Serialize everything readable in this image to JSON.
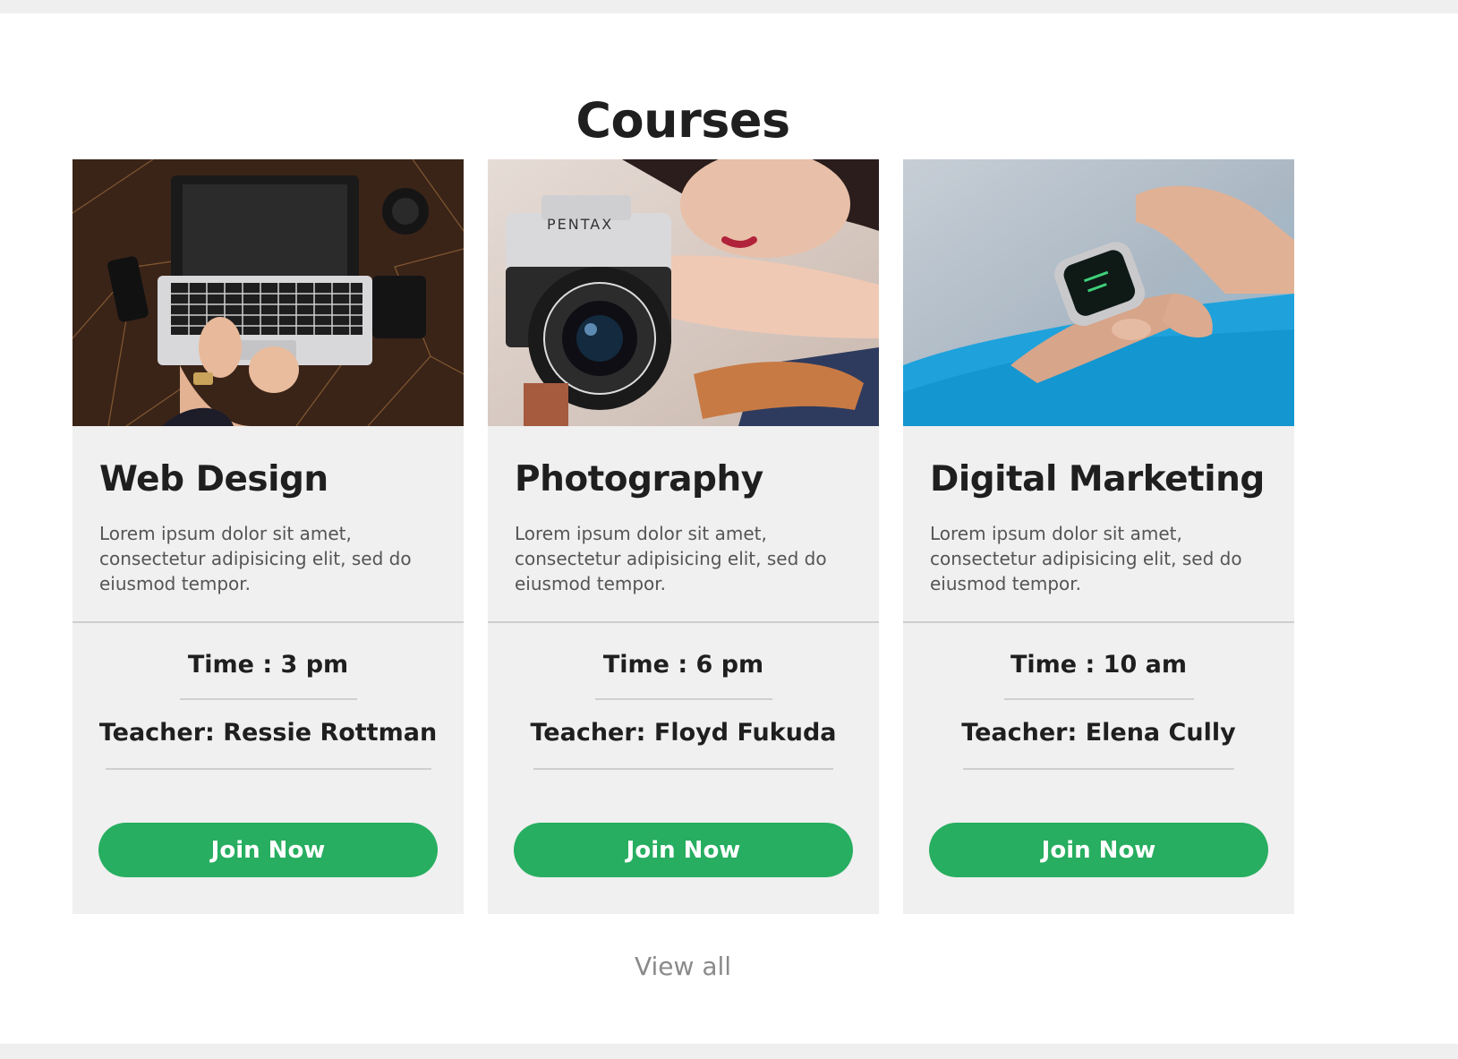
{
  "section": {
    "title": "Courses",
    "view_all_label": "View all"
  },
  "courses": [
    {
      "title": "Web Design",
      "description": "Lorem ipsum dolor sit amet, consectetur adipisicing elit, sed do eiusmod tempor.",
      "time": "Time : 3 pm",
      "teacher": "Teacher: Ressie Rottman",
      "button_label": "Join Now",
      "image": "laptop-on-wooden-desk-photo"
    },
    {
      "title": "Photography",
      "description": "Lorem ipsum dolor sit amet, consectetur adipisicing elit, sed do eiusmod tempor.",
      "time": "Time : 6 pm",
      "teacher": "Teacher: Floyd Fukuda",
      "button_label": "Join Now",
      "image": "pentax-camera-with-woman-photo",
      "image_text": "PENTAX"
    },
    {
      "title": "Digital Marketing",
      "description": "Lorem ipsum dolor sit amet, consectetur adipisicing elit, sed do eiusmod tempor.",
      "time": "Time : 10 am",
      "teacher": "Teacher: Elena Cully",
      "button_label": "Join Now",
      "image": "smartwatch-on-wrist-photo"
    }
  ],
  "colors": {
    "accent_green": "#27ae60",
    "card_background": "#f0f0f0",
    "title_text": "#1f1f1f",
    "muted_text": "#8a8a8a"
  }
}
